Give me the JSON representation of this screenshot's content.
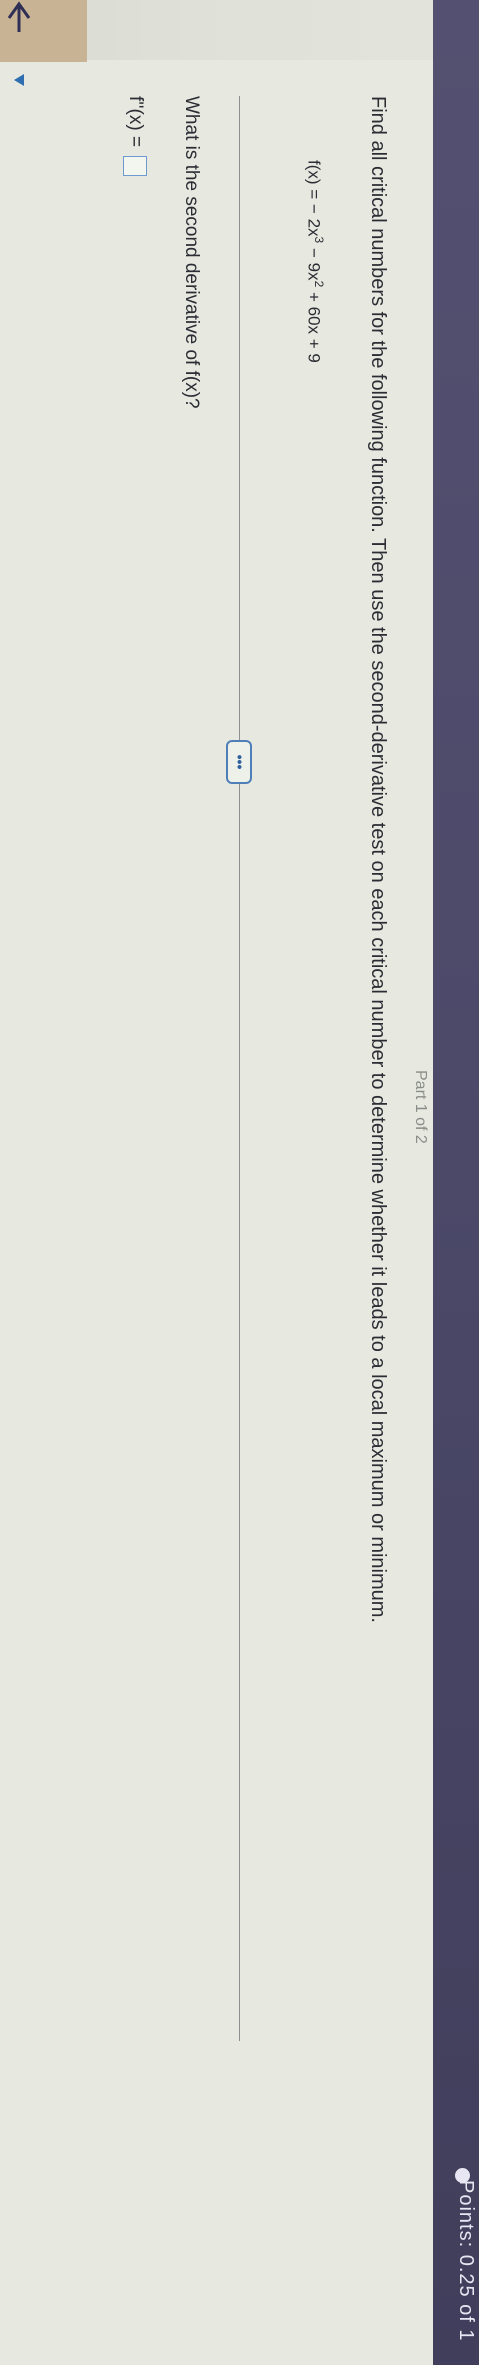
{
  "header": {
    "part": "Part 1 of 2",
    "points": "Points: 0.25 of 1"
  },
  "question": {
    "prompt": "Find all critical numbers for the following function. Then use the second-derivative test on each critical number to determine whether it leads to a local maximum or minimum.",
    "function_prefix": "f(x) = − 2x",
    "exp1": "3",
    "function_mid": " − 9x",
    "exp2": "2",
    "function_suffix": " + 60x + 9"
  },
  "more_button": {
    "label": "•••"
  },
  "subquestion": {
    "text": "What is the second derivative of f(x)?",
    "answer_label": "f''(x) ="
  }
}
